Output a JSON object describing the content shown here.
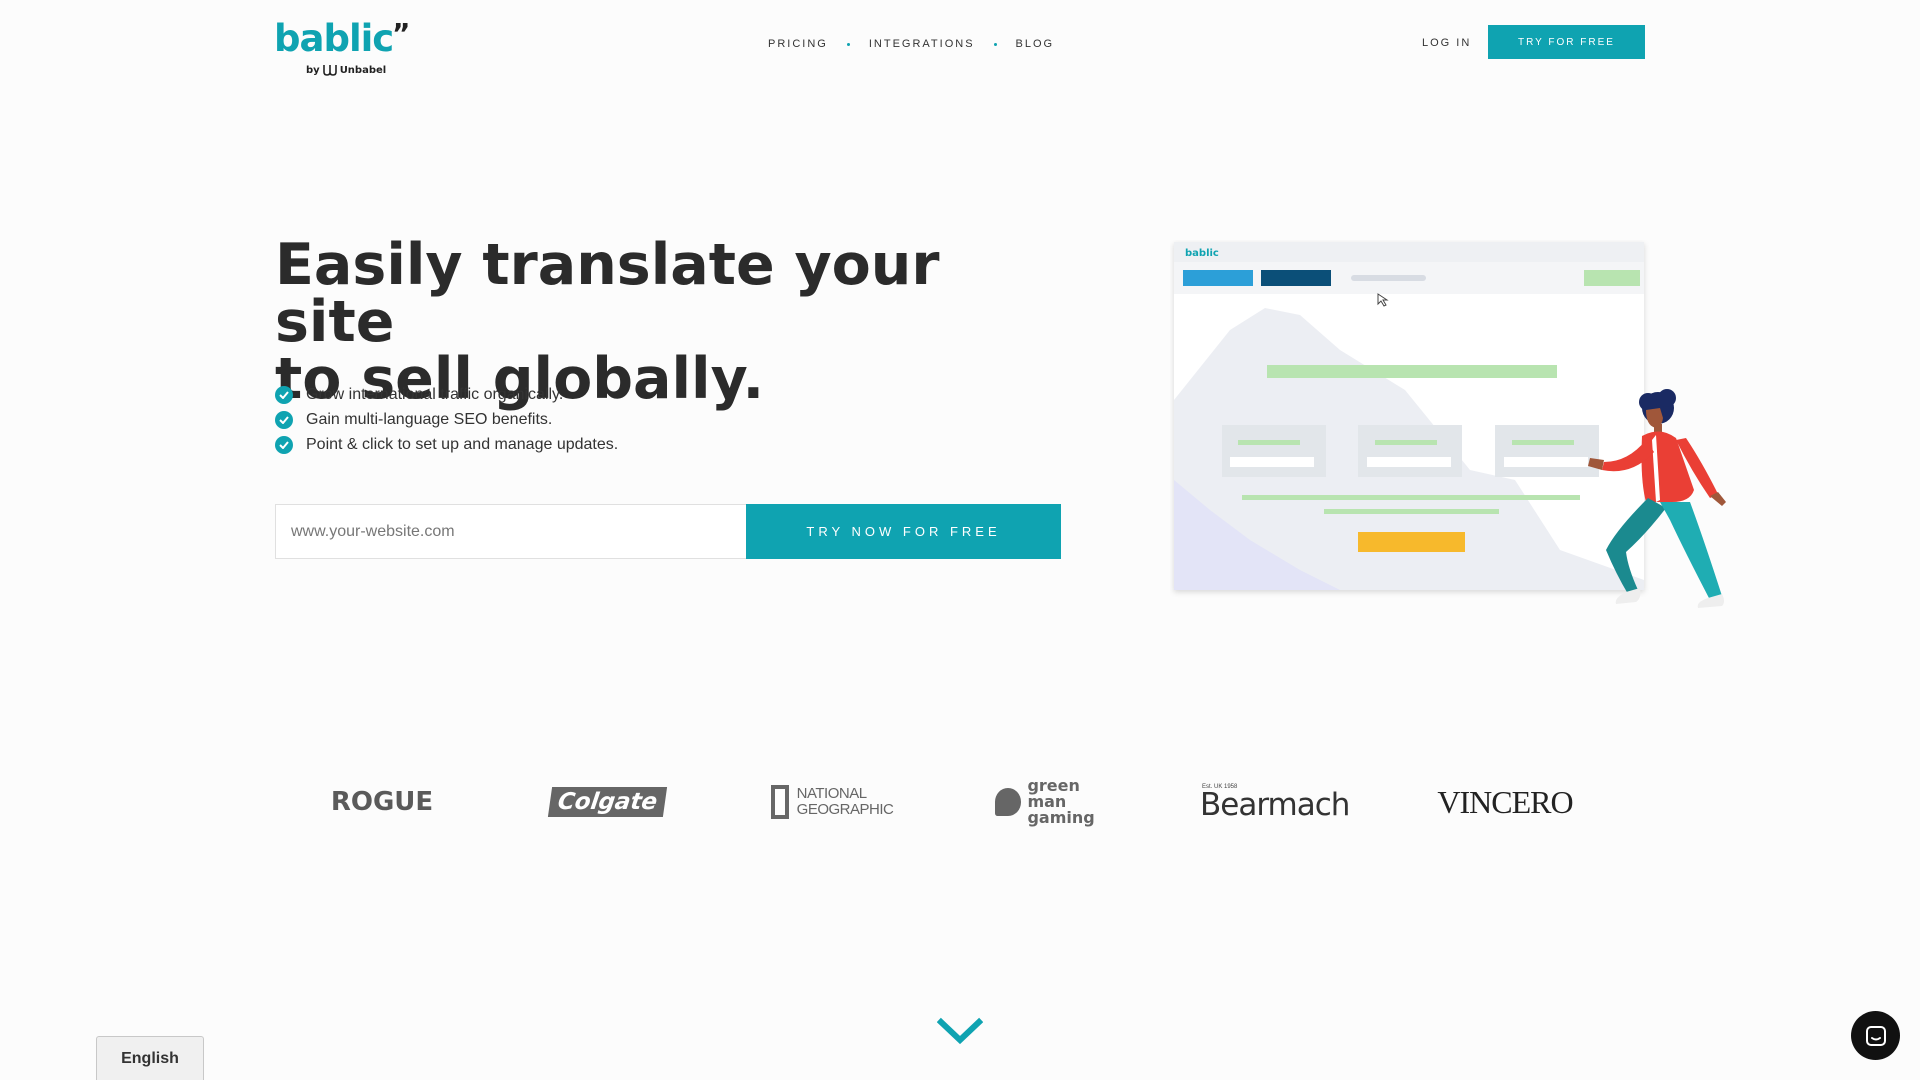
{
  "header": {
    "logo_text": "bablic",
    "logo_quote": "”",
    "logo_by": "by",
    "logo_partner": "Unbabel",
    "nav": [
      {
        "label": "PRICING"
      },
      {
        "label": "INTEGRATIONS"
      },
      {
        "label": "BLOG"
      }
    ],
    "login_label": "LOG IN",
    "try_label": "TRY FOR FREE"
  },
  "hero": {
    "headline_line1": "Easily translate your site",
    "headline_line2": "to sell globally.",
    "benefits": [
      {
        "text": "Grow international traffic organically."
      },
      {
        "text": "Gain multi-language SEO benefits."
      },
      {
        "text": "Point & click to set up and manage updates."
      }
    ],
    "url_placeholder": "www.your-website.com",
    "cta_label": "TRY NOW FOR FREE"
  },
  "illustration": {
    "window_logo": "bablic"
  },
  "clients": [
    {
      "name": "ROGUE"
    },
    {
      "name": "Colgate"
    },
    {
      "name_line1": "NATIONAL",
      "name_line2": "GEOGRAPHIC"
    },
    {
      "name_line1": "green man",
      "name_line2": "gaming"
    },
    {
      "prefix": "Est. UK 1958",
      "name": "Bearmach"
    },
    {
      "name": "VINCERO"
    }
  ],
  "footer": {
    "language": "English"
  },
  "colors": {
    "brand": "#0fa3b1",
    "text_dark": "#2b2b2b",
    "background": "#fcfcfc"
  },
  "icons": {
    "check": "check-circle-icon",
    "scroll": "chevron-down-icon",
    "chat": "chat-icon"
  }
}
